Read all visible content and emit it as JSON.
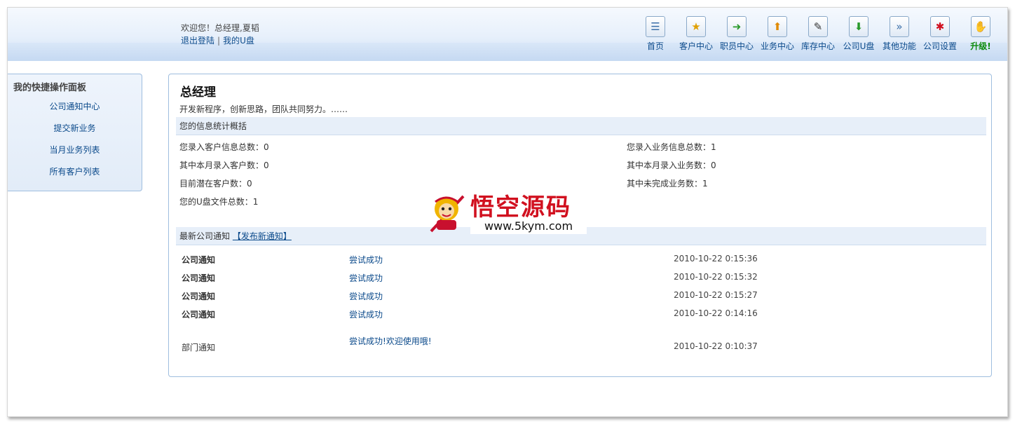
{
  "header": {
    "welcome": "欢迎您！总经理,夏韬",
    "logout": "退出登陆",
    "separator": "|",
    "my_disk": "我的U盘",
    "nav": [
      {
        "label": "首页",
        "icon": "home-icon",
        "glyph": "☰"
      },
      {
        "label": "客户中心",
        "icon": "customer-icon",
        "glyph": "★"
      },
      {
        "label": "职员中心",
        "icon": "staff-icon",
        "glyph": "➜"
      },
      {
        "label": "业务中心",
        "icon": "business-icon",
        "glyph": "⬆"
      },
      {
        "label": "库存中心",
        "icon": "inventory-icon",
        "glyph": "✎"
      },
      {
        "label": "公司U盘",
        "icon": "disk-icon",
        "glyph": "⬇"
      },
      {
        "label": "其他功能",
        "icon": "other-icon",
        "glyph": "»"
      },
      {
        "label": "公司设置",
        "icon": "settings-icon",
        "glyph": "✱"
      },
      {
        "label": "升级!",
        "icon": "upgrade-icon",
        "glyph": "✋"
      }
    ]
  },
  "sidebar": {
    "title": "我的快捷操作面板",
    "items": [
      {
        "label": "公司通知中心"
      },
      {
        "label": "提交新业务"
      },
      {
        "label": "当月业务列表"
      },
      {
        "label": "所有客户列表"
      }
    ]
  },
  "main": {
    "title": "总经理",
    "motto": "开发新程序，创新思路，团队共同努力。……",
    "stats_header": "您的信息统计概括",
    "stats_left": [
      "您录入客户信息总数：0",
      "其中本月录入客户数：0",
      "目前潜在客户数：0",
      "您的U盘文件总数：1"
    ],
    "stats_right": [
      "您录入业务信息总数：1",
      "其中本月录入业务数：0",
      "其中未完成业务数：1"
    ],
    "notices_header": "最新公司通知",
    "publish_link": "【发布新通知】",
    "notices": [
      {
        "type": "公司通知",
        "title": "尝试成功",
        "time": "2010-10-22 0:15:36"
      },
      {
        "type": "公司通知",
        "title": "尝试成功",
        "time": "2010-10-22 0:15:32"
      },
      {
        "type": "公司通知",
        "title": "尝试成功",
        "time": "2010-10-22 0:15:27"
      },
      {
        "type": "公司通知",
        "title": "尝试成功",
        "time": "2010-10-22 0:14:16"
      },
      {
        "type": "部门通知",
        "title": "尝试成功!欢迎使用哦!",
        "time": "2010-10-22 0:10:37"
      }
    ]
  },
  "watermark": {
    "brand": "悟空源码",
    "url": "www.5kym.com"
  }
}
